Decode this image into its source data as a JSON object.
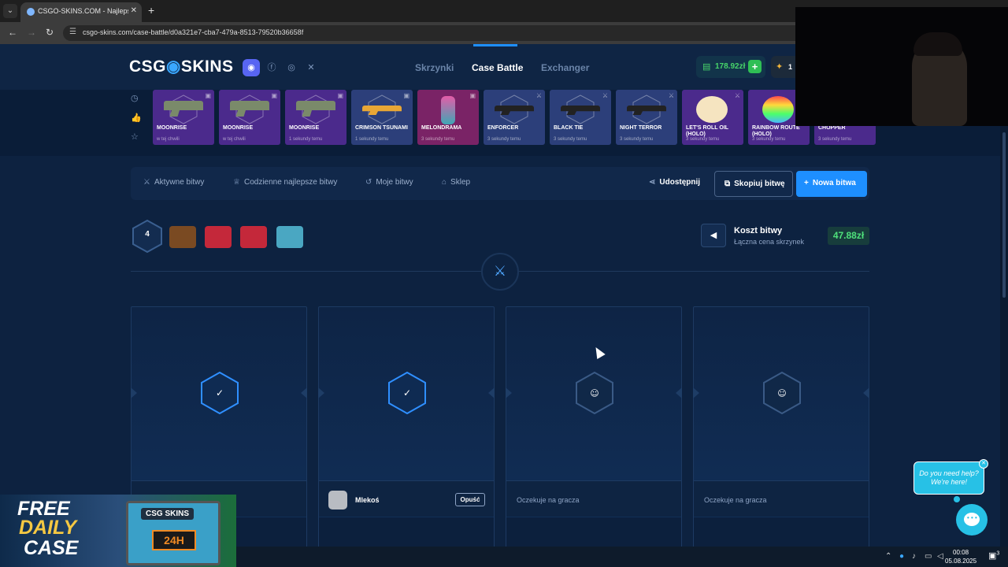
{
  "browser": {
    "tab_title": "CSGO-SKINS.COM - Najlepsze",
    "url": "csgo-skins.com/case-battle/d0a321e7-cba7-479a-8513-79520b36658f"
  },
  "header": {
    "logo_left": "CSG",
    "logo_right": "SKINS",
    "nav": [
      "Skrzynki",
      "Case Battle",
      "Exchanger"
    ],
    "active_nav": "Case Battle",
    "balance": "178.92zł",
    "coins": "1"
  },
  "live_drops": [
    {
      "name": "MOONRISE",
      "time": "w tej chwili",
      "color": "purple",
      "icon": "pistol"
    },
    {
      "name": "MOONRISE",
      "time": "w tej chwili",
      "color": "purple",
      "icon": "pistol"
    },
    {
      "name": "MOONRISE",
      "time": "1 sekundy temu",
      "color": "purple",
      "icon": "pistol"
    },
    {
      "name": "CRIMSON TSUNAMI",
      "time": "1 sekundy temu",
      "color": "blue",
      "icon": "rifle"
    },
    {
      "name": "MELONDRAMA",
      "time": "3 sekundy temu",
      "color": "pink",
      "icon": "knife"
    },
    {
      "name": "ENFORCER",
      "time": "3 sekundy temu",
      "color": "blue",
      "icon": "rifle"
    },
    {
      "name": "BLACK TIE",
      "time": "3 sekundy temu",
      "color": "blue",
      "icon": "rifle"
    },
    {
      "name": "NIGHT TERROR",
      "time": "3 sekundy temu",
      "color": "blue",
      "icon": "rifle"
    },
    {
      "name": "LET'S ROLL OIL (HOLO)",
      "time": "3 sekundy temu",
      "color": "purple",
      "icon": "sticker"
    },
    {
      "name": "RAINBOW ROUTE (HOLO)",
      "time": "3 sekundy temu",
      "color": "purple",
      "icon": "sticker"
    },
    {
      "name": "CHOPPER",
      "time": "3 sekundy temu",
      "color": "purple",
      "icon": "smg"
    }
  ],
  "toolbar": {
    "active": "Aktywne bitwy",
    "daily": "Codzienne najlepsze bitwy",
    "mine": "Moje bitwy",
    "shop": "Sklep",
    "share": "Udostępnij",
    "copy": "Skopiuj bitwę",
    "new": "Nowa bitwa"
  },
  "battle": {
    "players": "4",
    "cost_title": "Koszt bitwy",
    "cost_subtitle": "Łączna cena skrzynek",
    "cost": "47.88zł"
  },
  "slots": [
    {
      "state": "joined",
      "name": "",
      "leave": ""
    },
    {
      "state": "joined",
      "name": "Mlekoś",
      "leave": "Opuść"
    },
    {
      "state": "waiting",
      "label": "Oczekuje na gracza"
    },
    {
      "state": "waiting",
      "label": "Oczekuje na gracza"
    }
  ],
  "promo": {
    "line1": "FREE",
    "line2": "DAILY",
    "line3": "CASE",
    "box_label": "CSG SKINS",
    "timer": "24H"
  },
  "help": {
    "line1": "Do you need help?",
    "line2": "We're here!"
  },
  "taskbar": {
    "time": "00:08",
    "date": "05.08.2025",
    "notifications": "3"
  }
}
